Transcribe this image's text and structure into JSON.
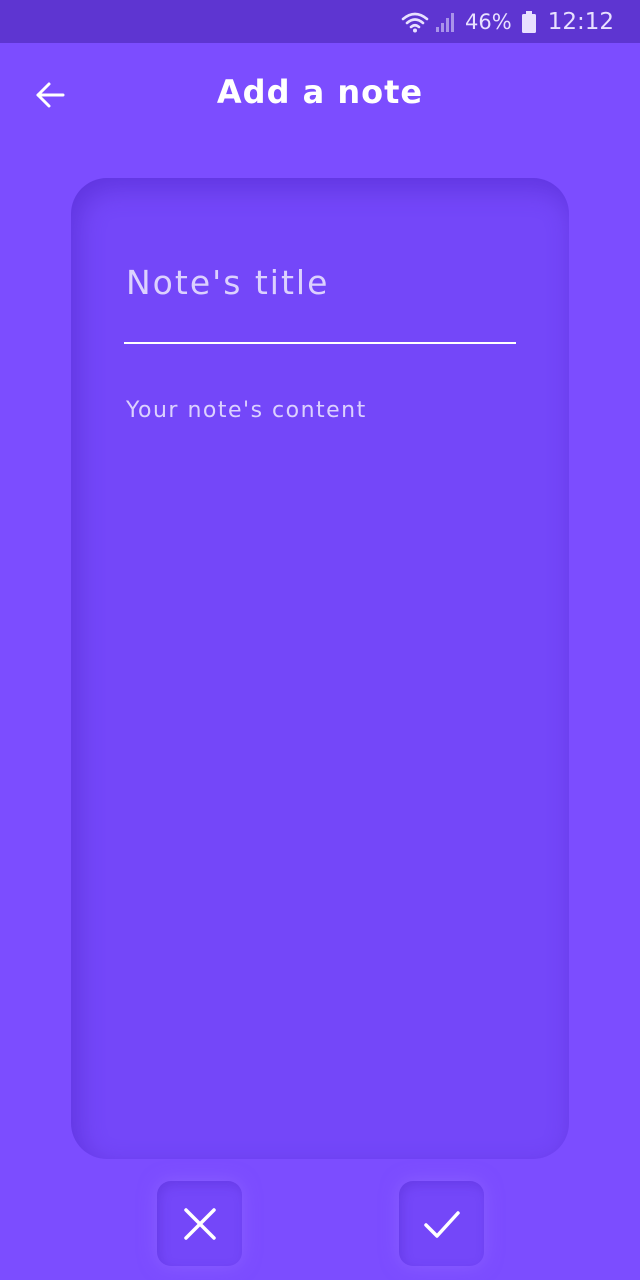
{
  "status_bar": {
    "battery_percent": "46%",
    "time": "12:12",
    "icons": [
      "wifi-icon",
      "signal-icon",
      "battery-icon"
    ]
  },
  "app_bar": {
    "title": "Add a note",
    "back_icon": "arrow-left-icon"
  },
  "note_form": {
    "title_placeholder": "Note's title",
    "title_value": "",
    "content_placeholder": "Your note's content",
    "content_value": ""
  },
  "actions": {
    "cancel_icon": "close-icon",
    "confirm_icon": "check-icon"
  },
  "colors": {
    "background": "#7c4dff",
    "status_bar": "#5e35d1",
    "card": "#7447f9",
    "text": "#ffffff"
  }
}
